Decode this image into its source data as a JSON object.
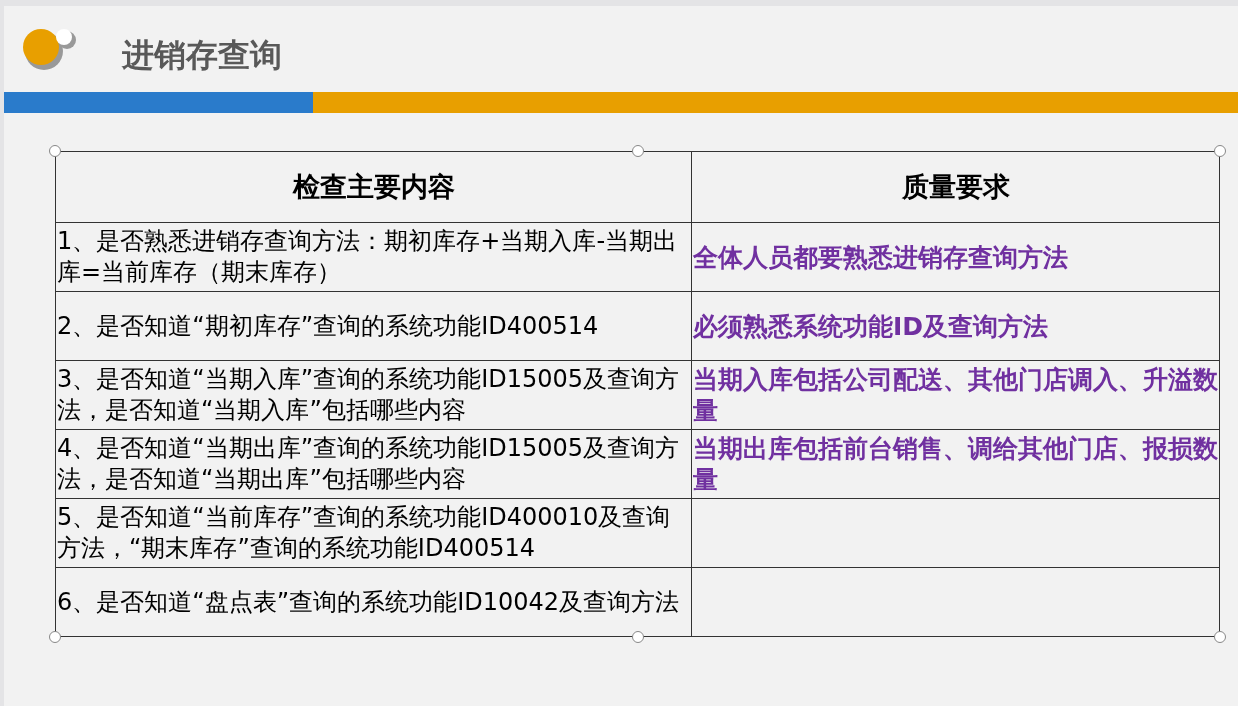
{
  "slide": {
    "title": "进销存查询",
    "table": {
      "columns": [
        "检查主要内容",
        "质量要求"
      ],
      "rows": [
        {
          "content": "1、是否熟悉进销存查询方法：期初库存+当期入库-当期出库=当前库存（期末库存）",
          "requirement": "全体人员都要熟悉进销存查询方法"
        },
        {
          "content": "2、是否知道“期初库存”查询的系统功能ID400514",
          "requirement": "必须熟悉系统功能ID及查询方法"
        },
        {
          "content": "3、是否知道“当期入库”查询的系统功能ID15005及查询方法，是否知道“当期入库”包括哪些内容",
          "requirement": "当期入库包括公司配送、其他门店调入、升溢数量"
        },
        {
          "content": "4、是否知道“当期出库”查询的系统功能ID15005及查询方法，是否知道“当期出库”包括哪些内容",
          "requirement": "当期出库包括前台销售、调给其他门店、报损数量"
        },
        {
          "content": "5、是否知道“当前库存”查询的系统功能ID400010及查询方法，“期末库存”查询的系统功能ID400514"
        },
        {
          "content": "6、是否知道“盘点表”查询的系统功能ID10042及查询方法"
        }
      ]
    }
  }
}
